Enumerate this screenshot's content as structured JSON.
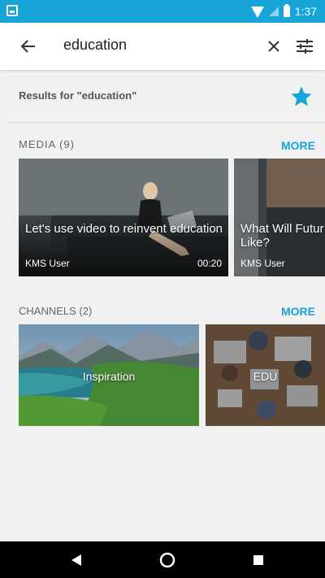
{
  "status_bar": {
    "time": "1:37"
  },
  "app_bar": {
    "query": "education"
  },
  "results": {
    "text": "Results for \"education\""
  },
  "media_section": {
    "title": "MEDIA (9)",
    "more": "MORE"
  },
  "media_items": [
    {
      "title": "Let's use video to reinvent education",
      "author": "KMS User",
      "duration": "00:20"
    },
    {
      "title": "What Will Futur Like?",
      "author": "KMS User"
    }
  ],
  "channels_section": {
    "title": "CHANNELS (2)",
    "more": "MORE"
  },
  "channel_items": [
    {
      "name": "Inspiration"
    },
    {
      "name": "EDU"
    }
  ],
  "colors": {
    "accent": "#16a5d6",
    "link": "#1aa1db"
  }
}
